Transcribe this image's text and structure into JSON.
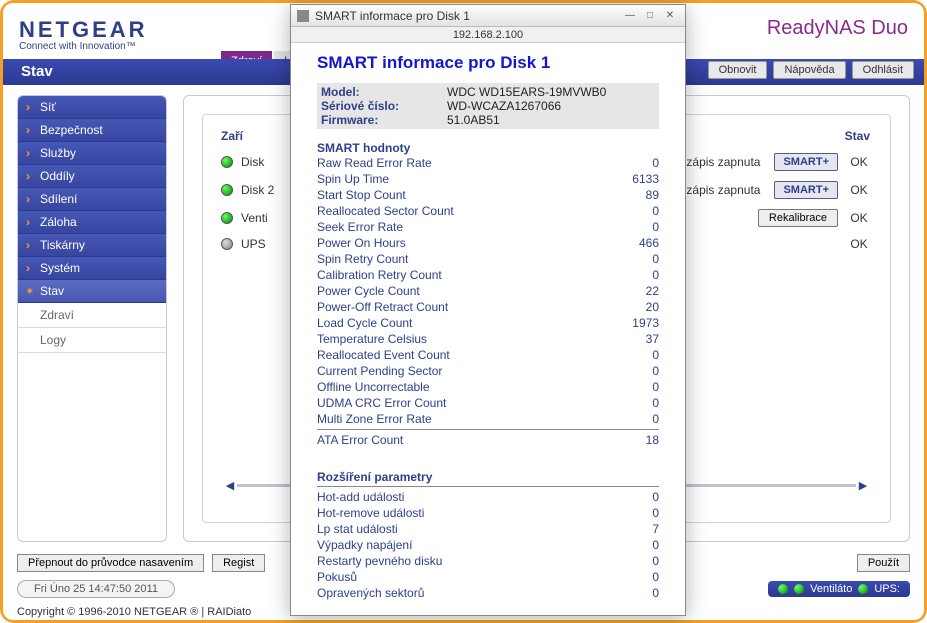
{
  "brand": {
    "name": "NETGEAR",
    "tagline": "Connect with Innovation™",
    "product": "ReadyNAS Duo"
  },
  "topTabs": {
    "active": "Zdraví",
    "other": "Logy"
  },
  "bar": {
    "title": "Stav",
    "refresh": "Obnovit",
    "help": "Nápověda",
    "logout": "Odhlásit"
  },
  "sidebar": {
    "items": [
      "Síť",
      "Bezpečnost",
      "Služby",
      "Oddíly",
      "Sdílení",
      "Záloha",
      "Tiskárny",
      "Systém",
      "Stav"
    ],
    "subs": [
      "Zdraví",
      "Logy"
    ]
  },
  "mainPanel": {
    "heading": "Zaří",
    "stavHeader": "Stav",
    "rows": [
      {
        "dot": "green",
        "label": "Disk",
        "right": "zápis zapnuta",
        "btn": "SMART+",
        "ok": "OK"
      },
      {
        "dot": "green",
        "label": "Disk 2",
        "right": "zápis zapnuta",
        "btn": "SMART+",
        "ok": "OK"
      },
      {
        "dot": "green",
        "label": "Venti",
        "right": "",
        "btn": "Rekalibrace",
        "ok": "OK"
      },
      {
        "dot": "gray",
        "label": "UPS",
        "right": "",
        "btn": "",
        "ok": "OK"
      }
    ]
  },
  "bottom": {
    "wizard": "Přepnout do průvodce nasavením",
    "register": "Regist",
    "apply": "Použít",
    "time": "Fri Úno 25  14:47:50 2011",
    "status": [
      "Ventiláto",
      "UPS:"
    ]
  },
  "footer": "Copyright © 1996-2010 NETGEAR ® | RAIDiato",
  "modal": {
    "winTitle": "SMART informace pro Disk 1",
    "address": "192.168.2.100",
    "heading": "SMART informace pro Disk 1",
    "info": [
      {
        "label": "Model:",
        "value": "WDC WD15EARS-19MVWB0"
      },
      {
        "label": "Sériové číslo:",
        "value": "WD-WCAZA1267066"
      },
      {
        "label": "Firmware:",
        "value": "51.0AB51"
      }
    ],
    "smartTitle": "SMART hodnoty",
    "smart": [
      {
        "l": "Raw Read Error Rate",
        "v": "0"
      },
      {
        "l": "Spin Up Time",
        "v": "6133"
      },
      {
        "l": "Start Stop Count",
        "v": "89"
      },
      {
        "l": "Reallocated Sector Count",
        "v": "0"
      },
      {
        "l": "Seek Error Rate",
        "v": "0"
      },
      {
        "l": "Power On Hours",
        "v": "466"
      },
      {
        "l": "Spin Retry Count",
        "v": "0"
      },
      {
        "l": "Calibration Retry Count",
        "v": "0"
      },
      {
        "l": "Power Cycle Count",
        "v": "22"
      },
      {
        "l": "Power-Off Retract Count",
        "v": "20"
      },
      {
        "l": "Load Cycle Count",
        "v": "1973"
      },
      {
        "l": "Temperature Celsius",
        "v": "37"
      },
      {
        "l": "Reallocated Event Count",
        "v": "0"
      },
      {
        "l": "Current Pending Sector",
        "v": "0"
      },
      {
        "l": "Offline Uncorrectable",
        "v": "0"
      },
      {
        "l": "UDMA CRC Error Count",
        "v": "0"
      },
      {
        "l": "Multi Zone Error Rate",
        "v": "0"
      }
    ],
    "ata": {
      "l": "ATA Error Count",
      "v": "18"
    },
    "extTitle": "Rozšíření parametry",
    "ext": [
      {
        "l": "Hot-add události",
        "v": "0"
      },
      {
        "l": "Hot-remove události",
        "v": "0"
      },
      {
        "l": "Lp stat události",
        "v": "7"
      },
      {
        "l": "Výpadky napájení",
        "v": "0"
      },
      {
        "l": "Restarty pevného disku",
        "v": "0"
      },
      {
        "l": "Pokusů",
        "v": "0"
      },
      {
        "l": "Opravených sektorů",
        "v": "0"
      }
    ]
  }
}
